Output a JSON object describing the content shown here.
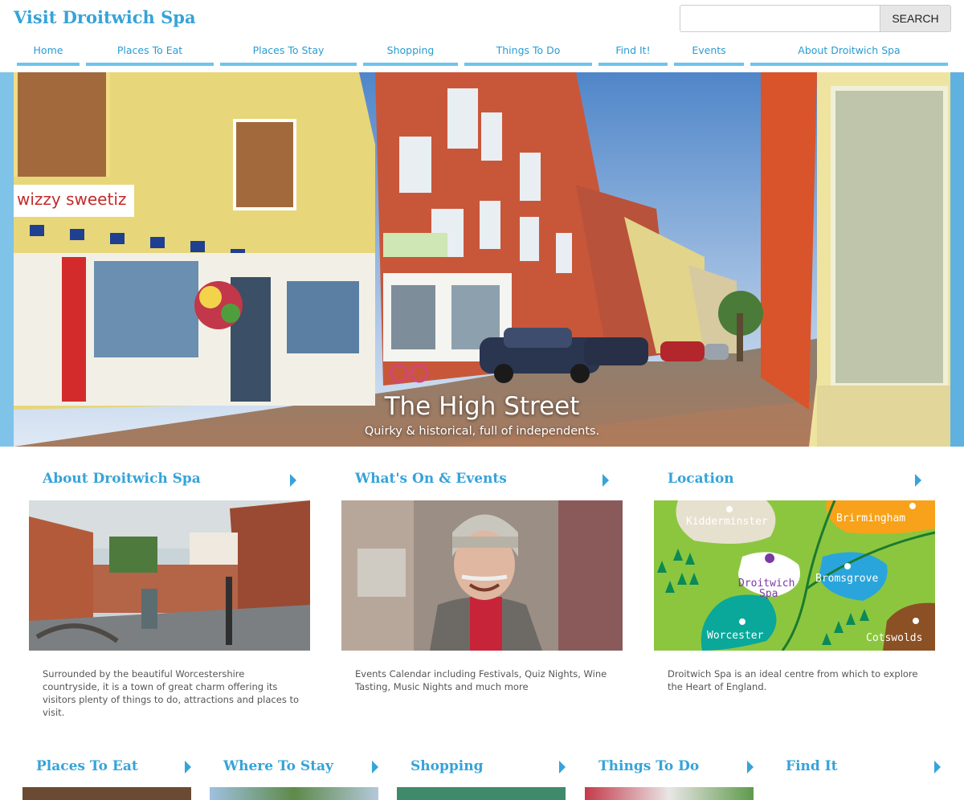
{
  "header": {
    "site_title": "Visit Droitwich Spa",
    "search_placeholder": "",
    "search_button": "SEARCH"
  },
  "nav": {
    "items": [
      {
        "label": "Home"
      },
      {
        "label": "Places To Eat"
      },
      {
        "label": "Places To Stay"
      },
      {
        "label": "Shopping"
      },
      {
        "label": "Things To Do"
      },
      {
        "label": "Find It!"
      },
      {
        "label": "Events"
      },
      {
        "label": "About Droitwich Spa"
      }
    ]
  },
  "hero": {
    "title": "The High Street",
    "subtitle": "Quirky & historical, full of independents.",
    "shop_sign": "wizzy sweetiz"
  },
  "cards": [
    {
      "title": "About Droitwich Spa",
      "description": "Surrounded by the beautiful Worcestershire countryside, it is a town of great charm offering its visitors plenty of things to do, attractions and places to visit."
    },
    {
      "title": "What's On & Events",
      "description": "Events Calendar including Festivals, Quiz Nights, Wine Tasting, Music Nights and much more"
    },
    {
      "title": "Location",
      "description": "Droitwich Spa is an ideal centre from which to explore the Heart of England."
    }
  ],
  "map": {
    "labels": {
      "kidderminster": "Kidderminster",
      "birmingham": "Brirmingham",
      "droitwich_1": "Droitwich",
      "droitwich_2": "Spa",
      "bromsgrove": "Bromsgrove",
      "worcester": "Worcester",
      "cotswolds": "Cotswolds"
    }
  },
  "bottom": {
    "items": [
      {
        "title": "Places To Eat"
      },
      {
        "title": "Where To Stay"
      },
      {
        "title": "Shopping"
      },
      {
        "title": "Things To Do"
      },
      {
        "title": "Find It"
      }
    ]
  },
  "colors": {
    "accent": "#36a3d9",
    "nav_underline": "#6cc4ec",
    "map_green": "#8cc63f"
  }
}
